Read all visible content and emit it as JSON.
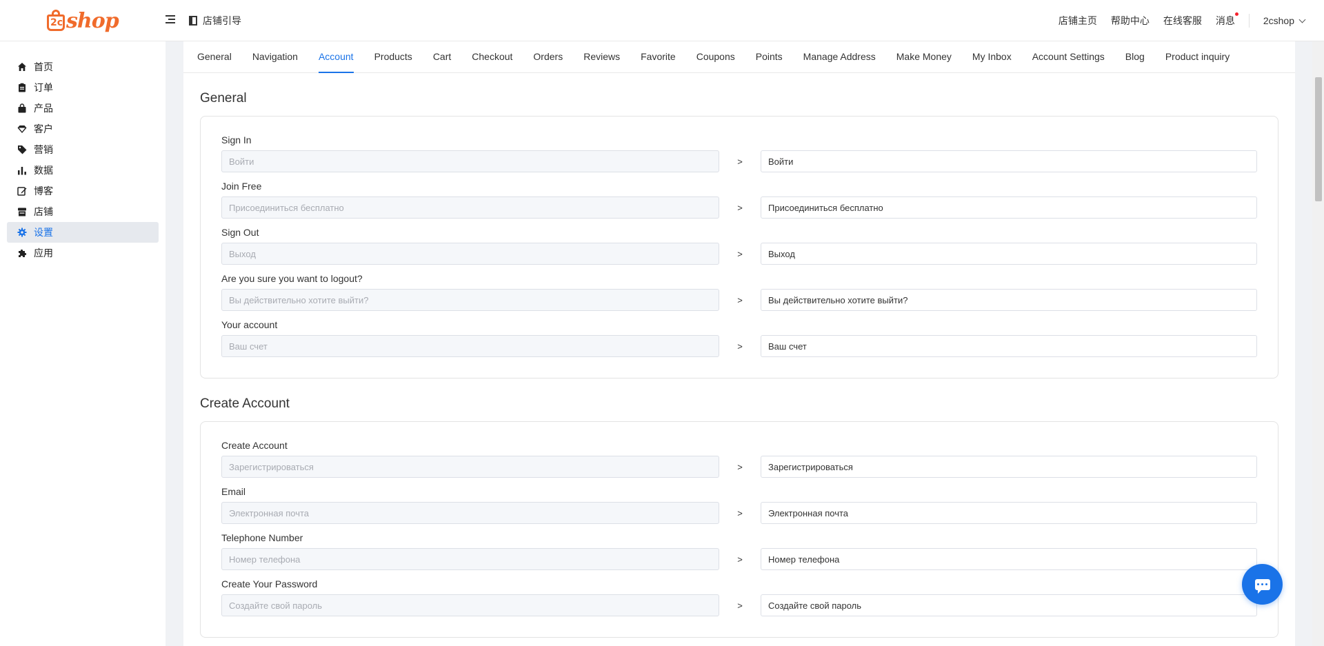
{
  "header": {
    "logo_num": "2c",
    "logo_text": "shop",
    "guide_label": "店铺引导",
    "links": [
      "店铺主页",
      "帮助中心",
      "在线客服",
      "消息"
    ],
    "user": "2cshop"
  },
  "sidebar": {
    "items": [
      {
        "label": "首页",
        "icon": "home-icon"
      },
      {
        "label": "订单",
        "icon": "clipboard-icon"
      },
      {
        "label": "产品",
        "icon": "shopping-bag-icon"
      },
      {
        "label": "客户",
        "icon": "diamond-icon"
      },
      {
        "label": "营销",
        "icon": "tag-icon"
      },
      {
        "label": "数据",
        "icon": "bar-chart-icon"
      },
      {
        "label": "博客",
        "icon": "edit-icon"
      },
      {
        "label": "店铺",
        "icon": "store-icon"
      },
      {
        "label": "设置",
        "icon": "gear-icon",
        "active": true
      },
      {
        "label": "应用",
        "icon": "puzzle-icon"
      }
    ]
  },
  "tabs": [
    "General",
    "Navigation",
    "Account",
    "Products",
    "Cart",
    "Checkout",
    "Orders",
    "Reviews",
    "Favorite",
    "Coupons",
    "Points",
    "Manage Address",
    "Make Money",
    "My Inbox",
    "Account Settings",
    "Blog",
    "Product inquiry"
  ],
  "active_tab": "Account",
  "sections": [
    {
      "title": "General",
      "rows": [
        {
          "label": "Sign In",
          "source": "Войти",
          "value": "Войти"
        },
        {
          "label": "Join Free",
          "source": "Присоединиться бесплатно",
          "value": "Присоединиться бесплатно"
        },
        {
          "label": "Sign Out",
          "source": "Выход",
          "value": "Выход"
        },
        {
          "label": "Are you sure you want to logout?",
          "source": "Вы действительно хотите выйти?",
          "value": "Вы действительно хотите выйти?"
        },
        {
          "label": "Your account",
          "source": "Ваш счет",
          "value": "Ваш счет"
        }
      ]
    },
    {
      "title": "Create Account",
      "rows": [
        {
          "label": "Create Account",
          "source": "Зарегистрироваться",
          "value": "Зарегистрироваться"
        },
        {
          "label": "Email",
          "source": "Электронная почта",
          "value": "Электронная почта"
        },
        {
          "label": "Telephone Number",
          "source": "Номер телефона",
          "value": "Номер телефона"
        },
        {
          "label": "Create Your Password",
          "source": "Создайте свой пароль",
          "value": "Создайте свой пароль"
        }
      ]
    }
  ],
  "arrow_symbol": ">",
  "colors": {
    "brand": "#f06b2b",
    "accent": "#1a73e8"
  }
}
